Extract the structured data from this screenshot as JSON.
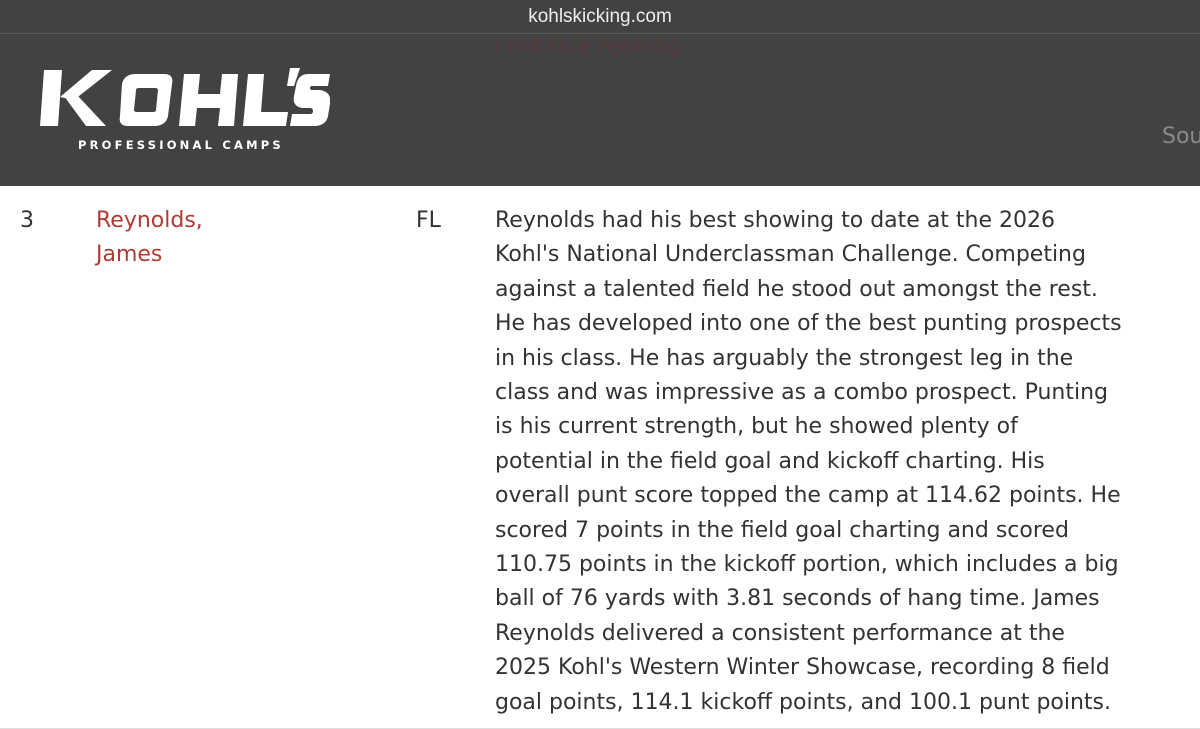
{
  "browser": {
    "url": "kohlskicking.com"
  },
  "header": {
    "continue_link": "continue reading",
    "logo": {
      "wordmark": "KOHL'S",
      "subtitle": "PROFESSIONAL CAMPS"
    },
    "nav_partial": "Sou"
  },
  "colors": {
    "header_bg": "#414244",
    "link_red": "#b03a34",
    "text": "#333333"
  },
  "ranking_row": {
    "rank": "3",
    "name": "Reynolds, James",
    "state": "FL",
    "description_lines": [
      "Reynolds had his best showing to date at the 2026",
      "Kohl's National Underclassman Challenge. Competing",
      "against a talented field he stood out amongst the rest.",
      "He has developed into one of the best punting prospects",
      "in his class. He has arguably the strongest leg in the",
      "class and was impressive as a combo prospect. Punting",
      "is his current strength, but he showed plenty of",
      "potential in the field goal and kickoff charting. His",
      "overall punt score topped the camp at 114.62 points. He",
      "scored 7 points in the field goal charting and scored",
      "110.75 points in the kickoff portion, which includes a big",
      "ball of 76 yards with 3.81 seconds of hang time. James",
      "Reynolds delivered a consistent performance at the",
      "2025 Kohl's Western Winter Showcase, recording 8 field",
      "goal points, 114.1 kickoff points, and 100.1 punt points."
    ]
  }
}
